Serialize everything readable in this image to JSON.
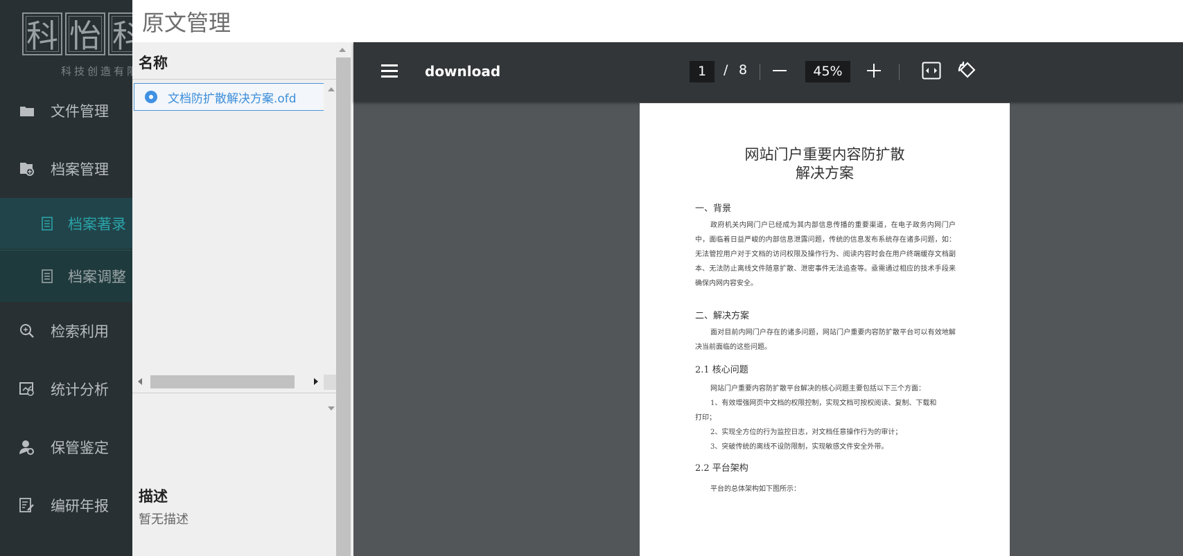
{
  "sidebar": {
    "logo_chars": [
      "科",
      "怡",
      "科"
    ],
    "logo_sub": "科技创造有限",
    "items": [
      {
        "label": "文件管理",
        "icon": "folder-icon"
      },
      {
        "label": "档案管理",
        "icon": "archive-icon"
      },
      {
        "label": "检索利用",
        "icon": "search-icon"
      },
      {
        "label": "统计分析",
        "icon": "chart-icon"
      },
      {
        "label": "保管鉴定",
        "icon": "user-gear-icon"
      },
      {
        "label": "编研年报",
        "icon": "report-icon"
      }
    ],
    "sub_items": [
      {
        "label": "档案著录",
        "icon": "document-icon",
        "active": true
      },
      {
        "label": "档案调整",
        "icon": "document-icon",
        "active": false
      }
    ],
    "accent_color": "#2aa3a8"
  },
  "panel": {
    "title": "原文管理",
    "name_header": "名称",
    "files": [
      {
        "name": "文档防扩散解决方案.ofd",
        "selected": true
      }
    ],
    "description_label": "描述",
    "description_value": "暂无描述"
  },
  "viewer": {
    "doc_title": "download",
    "current_page": "1",
    "page_separator": "/",
    "total_pages": "8",
    "zoom": "45%",
    "document": {
      "title_line1": "网站门户重要内容防扩散",
      "title_line2": "解决方案",
      "section1_title": "一、背景",
      "section1_text": "政府机关内网门户已经成为其内部信息传播的重要渠道，在电子政务内网门户中，面临着日益严峻的内部信息泄露问题，传统的信息发布系统存在诸多问题，如：无法管控用户对于文档的访问权限及操作行为、阅读内容时会在用户终端缓存文档副本、无法防止离线文件随意扩散、泄密事件无法追查等。亟需通过相应的技术手段来确保内网内容安全。",
      "section2_title": "二、解决方案",
      "section2_text": "面对目前内网门户存在的诸多问题，网站门户重要内容防扩散平台可以有效地解决当前面临的这些问题。",
      "section21_title": "2.1  核心问题",
      "section21_intro": "网站门户重要内容防扩散平台解决的核心问题主要包括以下三个方面：",
      "section21_item1a": "1、有效增强网页中文档的权限控制，实现文档可按权阅读、复制、下载和",
      "section21_item1b": "打印；",
      "section21_item2": "2、实现全方位的行为监控日志，对文档任意操作行为的审计；",
      "section21_item3": "3、突破传统的离线不设防限制，实现敏感文件安全外带。",
      "section22_title": "2.2 平台架构",
      "section22_text": "平台的总体架构如下图所示："
    }
  }
}
